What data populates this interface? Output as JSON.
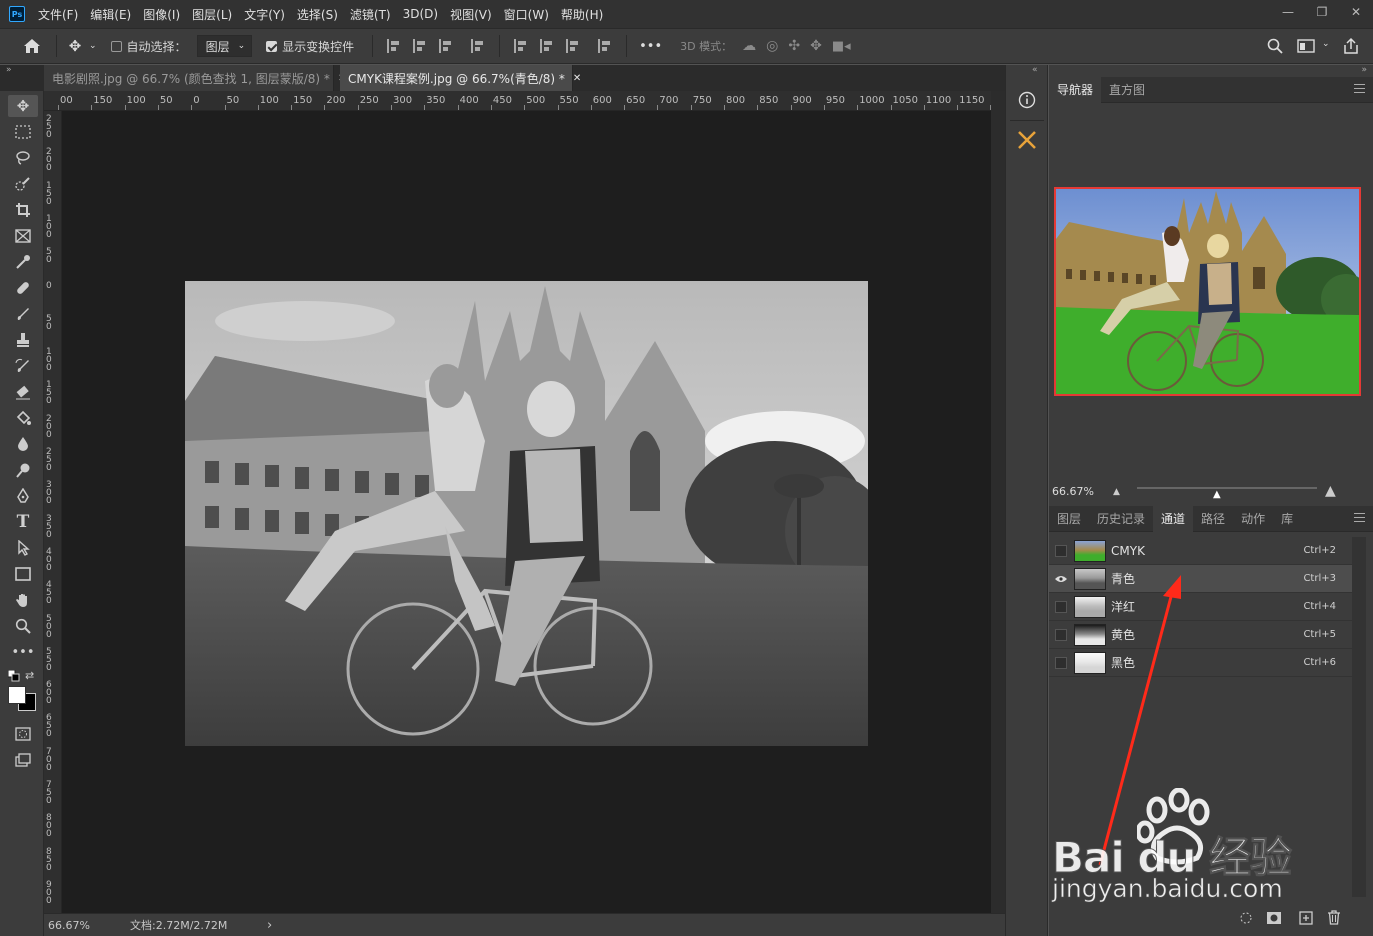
{
  "menubar": {
    "app_icon": "Ps",
    "items": [
      "文件(F)",
      "编辑(E)",
      "图像(I)",
      "图层(L)",
      "文字(Y)",
      "选择(S)",
      "滤镜(T)",
      "3D(D)",
      "视图(V)",
      "窗口(W)",
      "帮助(H)"
    ],
    "window_controls": [
      "minimize-icon",
      "restore-icon",
      "close-icon"
    ]
  },
  "options": {
    "auto_select_label": "自动选择：",
    "auto_select_target": "图层",
    "show_transform_label": "显示变换控件",
    "more": "•••",
    "mode_3d": "3D 模式："
  },
  "tabs": [
    {
      "label": "电影剧照.jpg @ 66.7% (颜色查找 1, 图层蒙版/8) *",
      "active": false
    },
    {
      "label": "CMYK课程案例.jpg @ 66.7%(青色/8) *",
      "active": true
    }
  ],
  "ruler": {
    "top": [
      "00",
      "150",
      "100",
      "50",
      "0",
      "50",
      "100",
      "150",
      "200",
      "250",
      "300",
      "350",
      "400",
      "450",
      "500",
      "550",
      "600",
      "650",
      "700",
      "750",
      "800",
      "850",
      "900",
      "950",
      "1000",
      "1050",
      "1100",
      "1150",
      "1"
    ],
    "left": [
      "250",
      "200",
      "150",
      "100",
      "50",
      "0",
      "50",
      "100",
      "150",
      "200",
      "250",
      "300",
      "350",
      "400",
      "450",
      "500",
      "550",
      "600",
      "650",
      "700",
      "750",
      "800",
      "850",
      "900"
    ]
  },
  "status": {
    "zoom": "66.67%",
    "doc": "文档:2.72M/2.72M",
    "arrow": "›"
  },
  "navigator": {
    "tabs": [
      "导航器",
      "直方图"
    ],
    "zoom": "66.67%"
  },
  "channels_panel": {
    "tabs": [
      "图层",
      "历史记录",
      "通道",
      "路径",
      "动作",
      "库"
    ],
    "active_tab": "通道",
    "channels": [
      {
        "name": "CMYK",
        "shortcut": "Ctrl+2",
        "visible": false,
        "selected": false,
        "thumb": "color"
      },
      {
        "name": "青色",
        "shortcut": "Ctrl+3",
        "visible": true,
        "selected": true,
        "thumb": "gray"
      },
      {
        "name": "洋红",
        "shortcut": "Ctrl+4",
        "visible": false,
        "selected": false,
        "thumb": "light"
      },
      {
        "name": "黄色",
        "shortcut": "Ctrl+5",
        "visible": false,
        "selected": false,
        "thumb": "dark"
      },
      {
        "name": "黑色",
        "shortcut": "Ctrl+6",
        "visible": false,
        "selected": false,
        "thumb": "white"
      }
    ]
  },
  "watermark": {
    "logo_text": "Bai du 经验",
    "url": "jingyan.baidu.com"
  },
  "colors": {
    "annotation_arrow": "#ff2a1a",
    "navigator_frame": "#e53935"
  }
}
